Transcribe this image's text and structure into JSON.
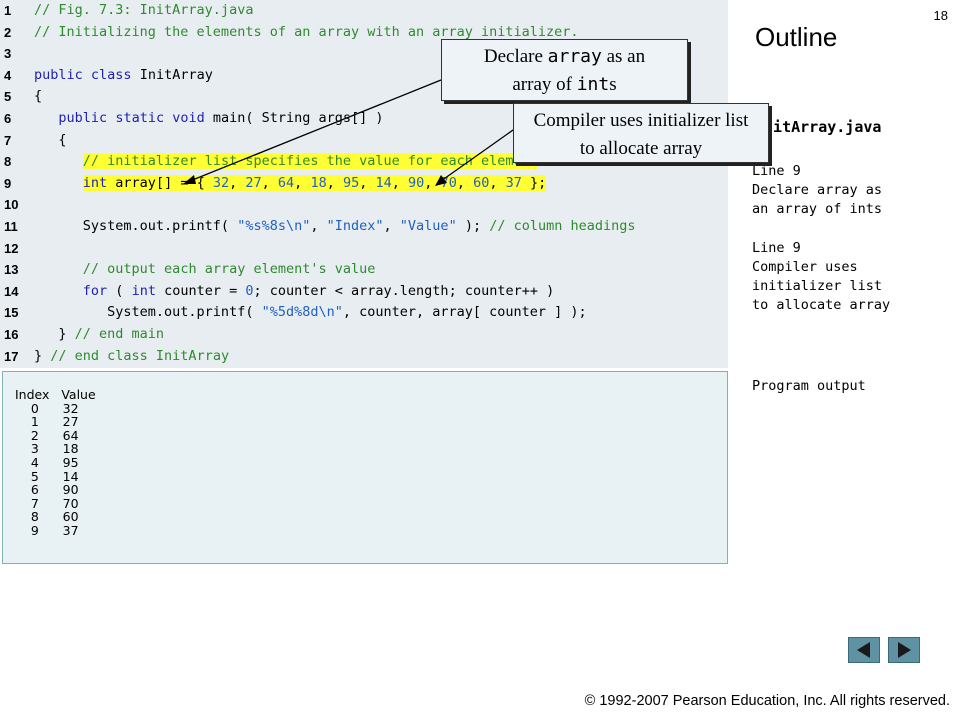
{
  "slide": {
    "number": "18",
    "outline_title": "Outline",
    "copyright": "© 1992-2007 Pearson Education, Inc.  All rights reserved."
  },
  "code": {
    "line_numbers": [
      "1",
      "2",
      "3",
      "4",
      "5",
      "6",
      "7",
      "8",
      "9",
      "10",
      "11",
      "12",
      "13",
      "14",
      "15",
      "16",
      "17"
    ],
    "lines": [
      "// Fig. 7.3: InitArray.java",
      "// Initializing the elements of an array with an array initializer.",
      "",
      "public class InitArray",
      "{",
      "   public static void main( String args[] )",
      "   {",
      "      // initializer list specifies the value for each element",
      "      int array[] = { 32, 27, 64, 18, 95, 14, 90, 70, 60, 37 };",
      "",
      "      System.out.printf( \"%s%8s\\n\", \"Index\", \"Value\" ); // column headings",
      "",
      "      // output each array element's value",
      "      for ( int counter = 0; counter < array.length; counter++ )",
      "         System.out.printf( \"%5d%8d\\n\", counter, array[ counter ] );",
      "   } // end main",
      "} // end class InitArray"
    ]
  },
  "output": {
    "header": "Index   Value",
    "rows": [
      "    0      32",
      "    1      27",
      "    2      64",
      "    3      18",
      "    4      95",
      "    5      14",
      "    6      90",
      "    7      70",
      "    8      60",
      "    9      37"
    ]
  },
  "callouts": {
    "declare": {
      "pre": "Declare ",
      "code": "array",
      "mid": " as an",
      "line2_pre": "array of ",
      "code2": "int",
      "line2_post": "s"
    },
    "compiler": {
      "line1": "Compiler uses initializer list",
      "line2": "to allocate array"
    }
  },
  "sidebar": {
    "file_name": "InitArray.java",
    "note1": "Line 9\nDeclare array as\nan array of ints",
    "note2": "Line 9\nCompiler uses\ninitializer list\nto allocate array",
    "note3": "Program output"
  },
  "colors": {
    "keyword": "#1f1fb4",
    "comment": "#2f8a2f",
    "string": "#2060c0",
    "highlight": "#ffff33",
    "nav_button": "#5f93a3"
  },
  "icons": {
    "prev": "triangle-left-icon",
    "next": "triangle-right-icon"
  }
}
